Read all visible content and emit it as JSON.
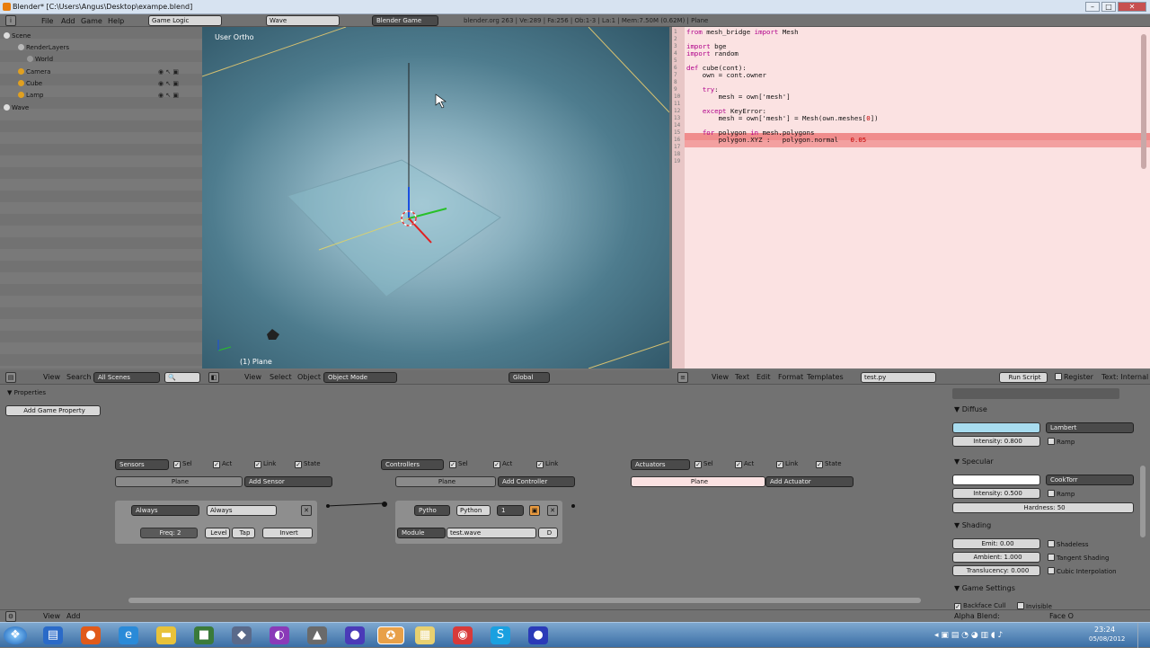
{
  "window": {
    "title": "Blender* [C:\\Users\\Angus\\Desktop\\exampe.blend]"
  },
  "top": {
    "menus": [
      "File",
      "Add",
      "Game",
      "Help"
    ],
    "screen": "Game Logic",
    "scene": "Wave",
    "engine": "Blender Game",
    "stats": "blender.org 263 | Ve:289 | Fa:256 | Ob:1-3 | La:1 | Mem:7.50M (0.62M) | Plane"
  },
  "outliner": {
    "items": [
      {
        "label": "Scene"
      },
      {
        "label": "RenderLayers"
      },
      {
        "label": "World"
      },
      {
        "label": "Camera"
      },
      {
        "label": "Cube"
      },
      {
        "label": "Lamp"
      },
      {
        "label": "Wave"
      }
    ],
    "menus": [
      "View",
      "Search"
    ],
    "filter": "All Scenes"
  },
  "viewport": {
    "label": "User Ortho",
    "object_label": "(1) Plane",
    "menus": [
      "View",
      "Select",
      "Object"
    ],
    "mode": "Object Mode",
    "orientation": "Global"
  },
  "editor": {
    "line_numbers": [
      "1",
      "2",
      "3",
      "4",
      "5",
      "6",
      "7",
      "8",
      "9",
      "10",
      "11",
      "12",
      "13",
      "14",
      "15",
      "16",
      "17",
      "18",
      "19"
    ],
    "lines": [
      {
        "t": "from mesh_bridge import Mesh"
      },
      {
        "t": ""
      },
      {
        "t": "import bge"
      },
      {
        "t": "import random"
      },
      {
        "t": ""
      },
      {
        "t": "def cube(cont):"
      },
      {
        "t": "    own = cont.owner"
      },
      {
        "t": ""
      },
      {
        "t": "    try:"
      },
      {
        "t": "        mesh = own['mesh']"
      },
      {
        "t": ""
      },
      {
        "t": "    except KeyError:"
      },
      {
        "t": "        mesh = own['mesh'] = Mesh(own.meshes[0])"
      },
      {
        "t": ""
      },
      {
        "t": "    for polygon in mesh.polygons"
      },
      {
        "t": "        polygon.XYZ :   polygon.normal   0.05"
      }
    ],
    "menus": [
      "View",
      "Text",
      "Edit",
      "Format",
      "Templates"
    ],
    "filename": "test.py",
    "run_label": "Run Script",
    "register_label": "Register",
    "text_internal": "Text: Internal"
  },
  "properties": {
    "header": "Properties",
    "add_game_property": "Add Game Property"
  },
  "logic": {
    "sensors": {
      "title": "Sensors",
      "object": "Plane",
      "add": "Add Sensor",
      "type": "Always",
      "name": "Always",
      "freq": "Freq: 2",
      "level": "Level",
      "tap": "Tap",
      "invert": "Invert"
    },
    "controllers": {
      "title": "Controllers",
      "object": "Plane",
      "add": "Add Controller",
      "type": "Pytho",
      "name": "Python",
      "num": "1",
      "mode": "Module",
      "module": "test.wave",
      "d": "D"
    },
    "actuators": {
      "title": "Actuators",
      "object": "Plane",
      "add": "Add Actuator"
    },
    "checks": {
      "sel": "Sel",
      "act": "Act",
      "link": "Link",
      "state": "State"
    }
  },
  "material": {
    "diffuse": {
      "title": "Diffuse",
      "shader": "Lambert",
      "intensity": "Intensity: 0.800",
      "ramp": "Ramp",
      "color": "#a8dcef"
    },
    "specular": {
      "title": "Specular",
      "shader": "CookTorr",
      "intensity": "Intensity: 0.500",
      "ramp": "Ramp",
      "hardness": "Hardness: 50",
      "color": "#ffffff"
    },
    "shading": {
      "title": "Shading",
      "emit": "Emit: 0.00",
      "ambient": "Ambient: 1.000",
      "translucency": "Translucency: 0.000",
      "shadeless": "Shadeless",
      "tangent": "Tangent Shading",
      "cubic": "Cubic Interpolation"
    },
    "game": {
      "title": "Game Settings",
      "backface": "Backface Cull",
      "invisible": "Invisible",
      "alpha_blend": "Alpha Blend:",
      "face_o": "Face O"
    }
  },
  "status": {
    "menus": [
      "View",
      "Add"
    ]
  },
  "taskbar": {
    "time": "23:24",
    "date": "05/08/2012"
  }
}
